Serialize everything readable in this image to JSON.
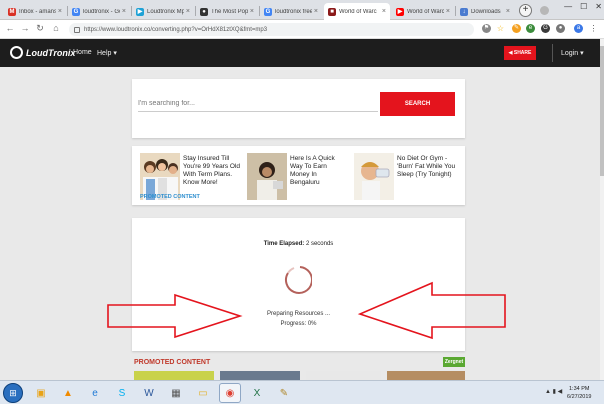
{
  "browser": {
    "tabs": [
      {
        "title": "Inbox - amanst",
        "favicon": "gmail-icon",
        "color": "#d93025",
        "glyph": "M"
      },
      {
        "title": "loudtronix - Go",
        "favicon": "google-icon",
        "color": "#4285f4",
        "glyph": "G"
      },
      {
        "title": "Loudtronix Mp",
        "favicon": "loudtronix-icon",
        "color": "#1fa2d6",
        "glyph": "▶"
      },
      {
        "title": "The Most Popu",
        "favicon": "github-icon",
        "color": "#333333",
        "glyph": "●"
      },
      {
        "title": "loudtronix free",
        "favicon": "google-icon",
        "color": "#4285f4",
        "glyph": "G"
      },
      {
        "title": "World of Warc",
        "favicon": "loudtronix-dark-icon",
        "color": "#8b1a1a",
        "glyph": "■"
      },
      {
        "title": "World of Warc",
        "favicon": "youtube-icon",
        "color": "#ff0000",
        "glyph": "▶"
      },
      {
        "title": "Downloads",
        "favicon": "download-icon",
        "color": "#4a7bd0",
        "glyph": "↓"
      }
    ],
    "active_tab": 5,
    "url": "https://www.loudtronix.co/converting.php?v=OrHdX81ztXQ&fmt=mp3"
  },
  "site": {
    "brand": "LoudTronix",
    "nav": {
      "home": "Home",
      "help": "Help ▾"
    },
    "share_label": "◀ SHARE",
    "login_label": "Login ▾"
  },
  "search": {
    "placeholder": "I'm searching for...",
    "button": "SEARCH"
  },
  "promos": [
    {
      "text": "Stay Insured Till You're 99 Years Old With Term Plans. Know More!"
    },
    {
      "text": "Here Is A Quick Way To Earn Money In Bengaluru"
    },
    {
      "text": "No Diet Or Gym - 'Burn' Fat While You Sleep (Try Tonight)"
    }
  ],
  "promoted_label": "PROMOTED CONTENT",
  "progress": {
    "elapsed_label": "Time Elapsed:",
    "elapsed_value": "2 seconds",
    "status": "Preparing Resources ...",
    "progress_text": "Progress: 0%",
    "percent": 0
  },
  "footer_promo": {
    "label": "PROMOTED CONTENT",
    "badge": "Zergnet"
  },
  "taskbar": {
    "time": "1:34 PM",
    "date": "6/27/2019"
  },
  "colors": {
    "accent": "#e4141d",
    "header": "#1d1d1d"
  }
}
